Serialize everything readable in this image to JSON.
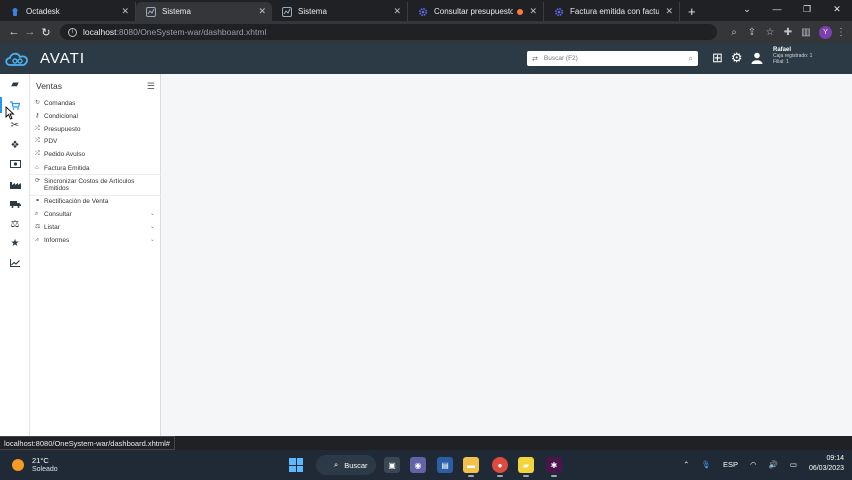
{
  "browser": {
    "tabs": [
      {
        "title": "Octadesk",
        "icon": "octadesk-icon",
        "active": false
      },
      {
        "title": "Sistema",
        "icon": "sistema-icon",
        "active": true
      },
      {
        "title": "Sistema",
        "icon": "sistema-icon",
        "active": false
      },
      {
        "title": "Consultar presupuestos",
        "icon": "gear-icon",
        "active": false,
        "recording": true
      },
      {
        "title": "Factura emitida con factura",
        "icon": "gear-icon",
        "active": false
      }
    ],
    "new_tab_label": "+",
    "window_controls": [
      "⌄",
      "—",
      "❐",
      "✕"
    ],
    "url_host": "localhost",
    "url_path": ":8080/OneSystem-war/dashboard.xhtml",
    "profile_initial": "Y"
  },
  "app": {
    "brand": "AVATI",
    "search": {
      "placeholder": "Buscar (F2)"
    },
    "user": {
      "name": "Rafael",
      "caja": "Caja registrado: 1",
      "filial": "Filial: 1"
    }
  },
  "sidebar": {
    "title": "Ventas",
    "items": [
      {
        "label": "Comandas",
        "icon": "refresh-icon",
        "chevron": false
      },
      {
        "label": "Condicional",
        "icon": "key-icon",
        "chevron": false
      },
      {
        "label": "Presupuesto",
        "icon": "shuffle-icon",
        "chevron": false
      },
      {
        "label": "PDV",
        "icon": "shuffle-icon",
        "chevron": false
      },
      {
        "label": "Pedido Avulso",
        "icon": "shuffle-icon",
        "chevron": false
      },
      {
        "label": "Factura Emitida",
        "icon": "factory-icon",
        "chevron": false
      },
      {
        "label": "Sincronizar Costos de Artículos Emitidos",
        "icon": "sync-icon",
        "chevron": false
      },
      {
        "label": "Rectificación de Venta",
        "icon": "handshake-icon",
        "chevron": false
      },
      {
        "label": "Consultar",
        "icon": "search-icon",
        "chevron": true
      },
      {
        "label": "Listar",
        "icon": "scale-icon",
        "chevron": true
      },
      {
        "label": "Informes",
        "icon": "chart-icon",
        "chevron": true
      }
    ]
  },
  "rail": [
    {
      "name": "book-icon"
    },
    {
      "name": "cart-icon",
      "active": true
    },
    {
      "name": "tools-icon"
    },
    {
      "name": "boxes-icon"
    },
    {
      "name": "money-icon"
    },
    {
      "name": "factory-icon"
    },
    {
      "name": "truck-icon"
    },
    {
      "name": "scale-icon"
    },
    {
      "name": "star-icon"
    },
    {
      "name": "trend-icon"
    }
  ],
  "statusbar": {
    "text": "localhost:8080/OneSystem-war/dashboard.xhtml#"
  },
  "taskbar": {
    "weather_temp": "21°C",
    "weather_cond": "Soleado",
    "search_label": "Buscar",
    "language": "ESP",
    "time": "09:14",
    "date": "06/03/2023"
  }
}
